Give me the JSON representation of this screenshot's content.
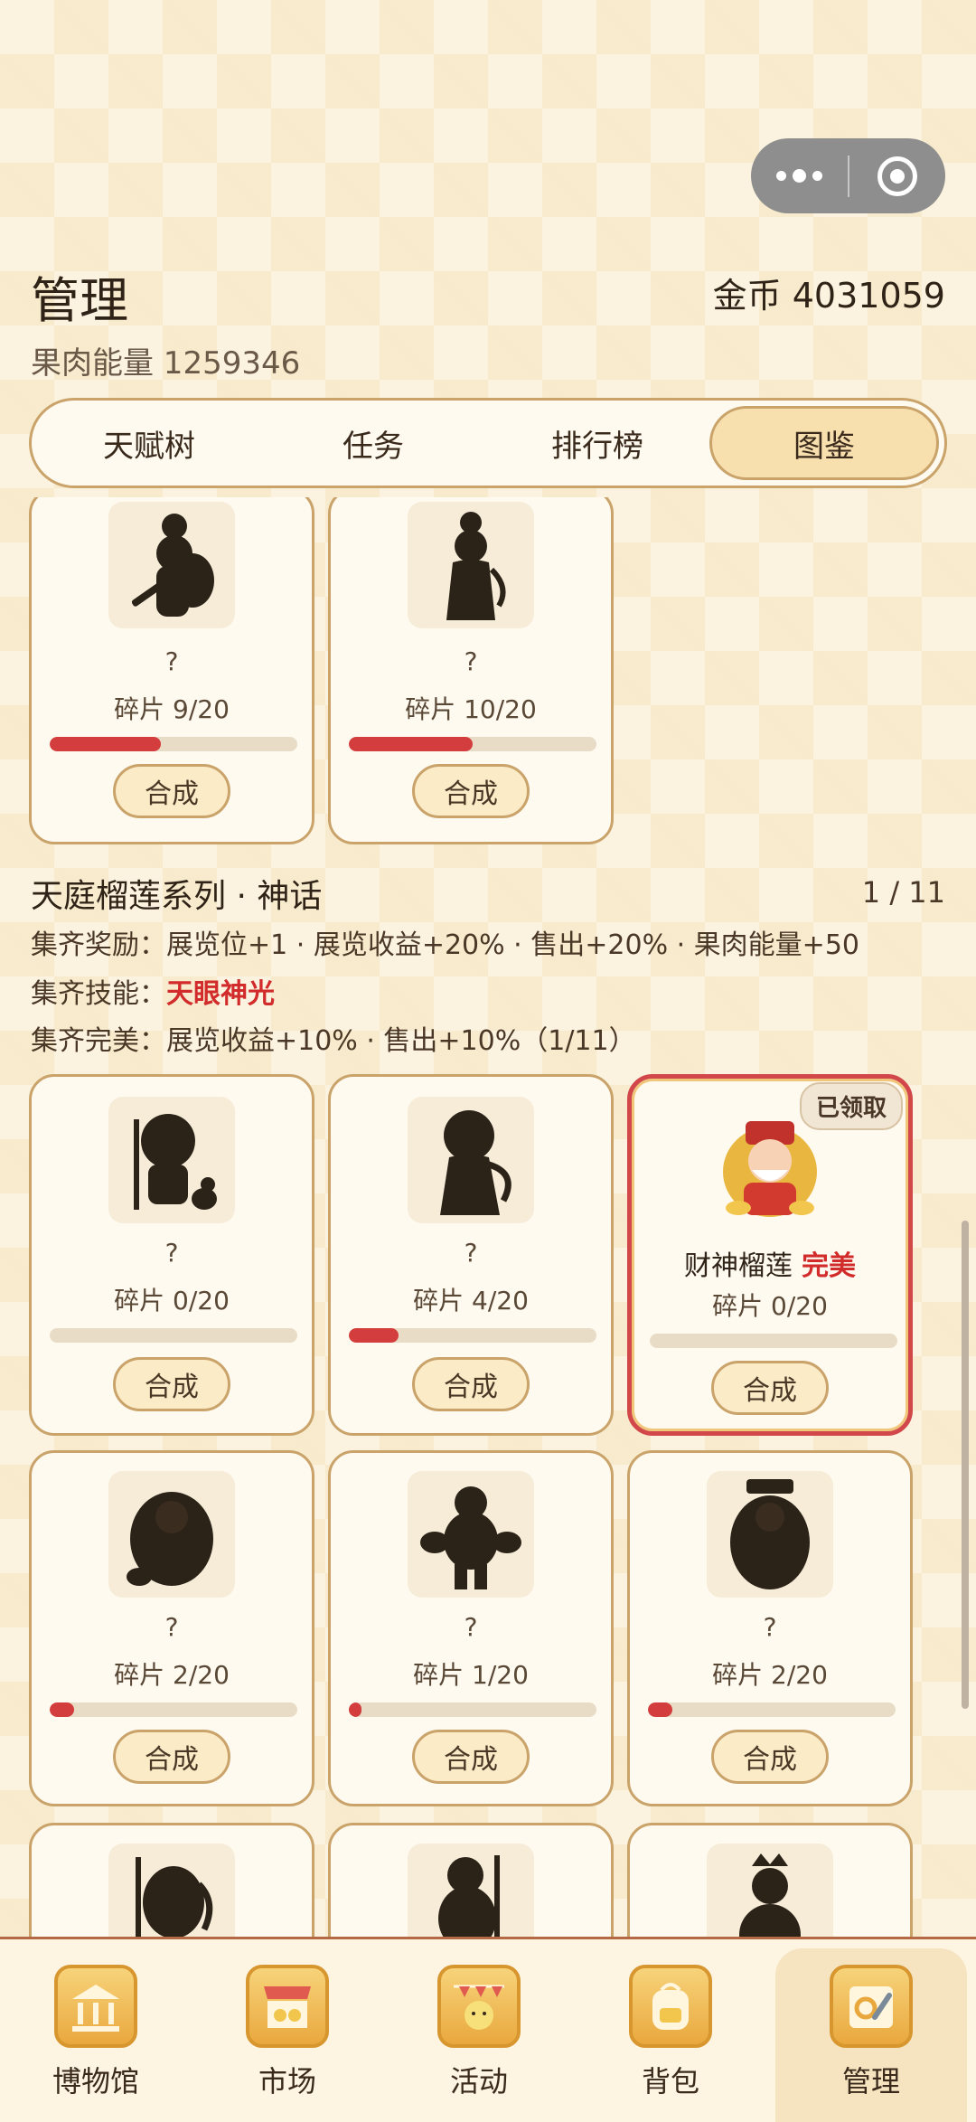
{
  "header": {
    "title": "管理",
    "coins": "金币 4031059",
    "energy": "果肉能量 1259346"
  },
  "tabs": [
    {
      "label": "天赋树",
      "active": false
    },
    {
      "label": "任务",
      "active": false
    },
    {
      "label": "排行榜",
      "active": false
    },
    {
      "label": "图鉴",
      "active": true
    }
  ],
  "prev_row": [
    {
      "name": "?",
      "fragments": "碎片 9/20",
      "progress": 0.45,
      "button": "合成"
    },
    {
      "name": "?",
      "fragments": "碎片 10/20",
      "progress": 0.5,
      "button": "合成"
    }
  ],
  "series": {
    "title": "天庭榴莲系列 · 神话",
    "count": "1 / 11",
    "reward_label": "集齐奖励：",
    "reward_text": "展览位+1 · 展览收益+20% · 售出+20% · 果肉能量+50",
    "skill_label": "集齐技能：",
    "skill_text": "天眼神光",
    "perfect_label": "集齐完美：",
    "perfect_text": "展览收益+10% · 售出+10%（1/11）"
  },
  "cards": [
    {
      "name": "?",
      "fragments": "碎片 0/20",
      "progress": 0.0,
      "button": "合成"
    },
    {
      "name": "?",
      "fragments": "碎片 4/20",
      "progress": 0.2,
      "button": "合成"
    },
    {
      "name": "财神榴莲",
      "perfect_tag": "完美",
      "badge": "已领取",
      "fragments": "碎片 0/20",
      "progress": 0.0,
      "button": "合成"
    },
    {
      "name": "?",
      "fragments": "碎片 2/20",
      "progress": 0.1,
      "button": "合成"
    },
    {
      "name": "?",
      "fragments": "碎片 1/20",
      "progress": 0.05,
      "button": "合成"
    },
    {
      "name": "?",
      "fragments": "碎片 2/20",
      "progress": 0.1,
      "button": "合成"
    }
  ],
  "bottom_nav": [
    {
      "label": "博物馆",
      "icon": "museum-icon",
      "active": false
    },
    {
      "label": "市场",
      "icon": "market-icon",
      "active": false
    },
    {
      "label": "活动",
      "icon": "event-icon",
      "active": false
    },
    {
      "label": "背包",
      "icon": "backpack-icon",
      "active": false
    },
    {
      "label": "管理",
      "icon": "manage-icon",
      "active": true
    }
  ]
}
